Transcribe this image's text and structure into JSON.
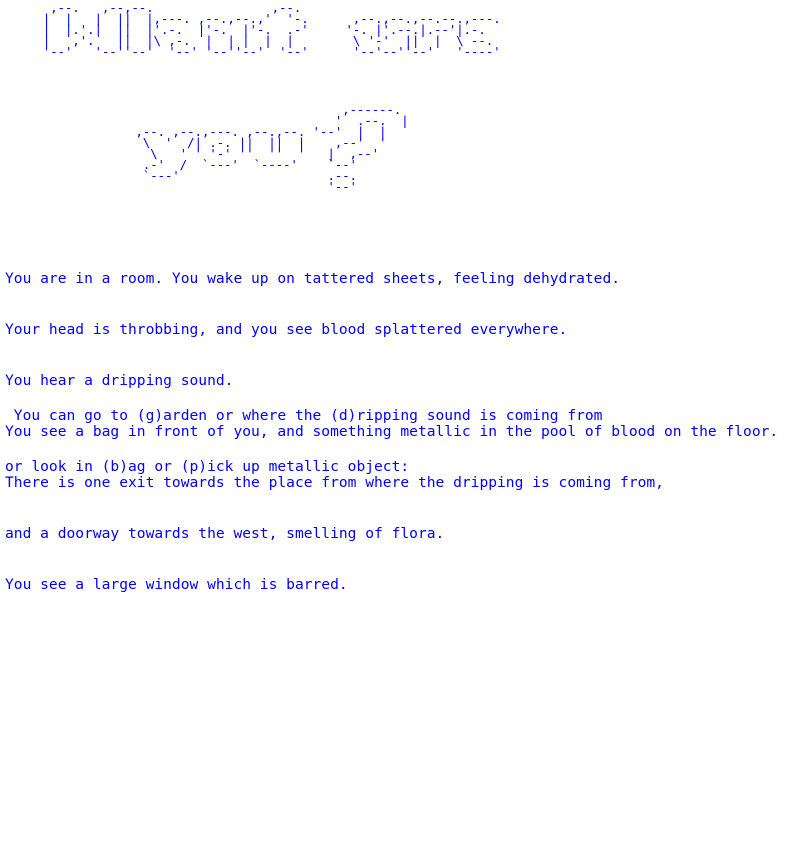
{
  "title_art": {
    "line1": [
      "   ,--.   ,--,--.                ,--.",
      "  |  |   |  ||  |,---. ,--.,--.,'  '-.      ,--.,--.,--.--.,---.",
      "  |  |.'.|  ||  |'.-.  |'-.  |'-.  .-'     '-. |'.--.|.--'|.-.",
      "  |   ,'.   ||  |\\ ,-.  |  | |  |  |        \\ '-'  ||  |  \\ --.",
      "  '--'   '--''--'  '--' '--''--'  '--'      '--'--''--'   '----'"
    ],
    "line2": [
      "                             ,------.",
      "                            '  .--.  |",
      " ,--. ,--.,---. ,--.,--. '--'  |  |",
      "  \\  '  /| .-. ||  ||  |    ,--'  '",
      "   \\   ' ' '-' ''  ''  '   |  ,--'",
      "  .-'  /  `---'  `----'    `--'",
      "  `---'                    .--.",
      "                           '--'"
    ]
  },
  "story": {
    "lines": [
      "You are in a room. You wake up on tattered sheets, feeling dehydrated.",
      "Your head is throbbing, and you see blood splattered everywhere.",
      "You hear a dripping sound.",
      "You see a bag in front of you, and something metallic in the pool of blood on the floor.",
      "There is one exit towards the place from where the dripping is coming from,",
      "and a doorway towards the west, smelling of flora.",
      "You see a large window which is barred."
    ]
  },
  "prompt": {
    "line1": " You can go to (g)arden or where the (d)ripping sound is coming from",
    "line2": "or look in (b)ag or (p)ick up metallic object: "
  },
  "colors": {
    "text": "#0000ff",
    "background": "#ffffff"
  }
}
